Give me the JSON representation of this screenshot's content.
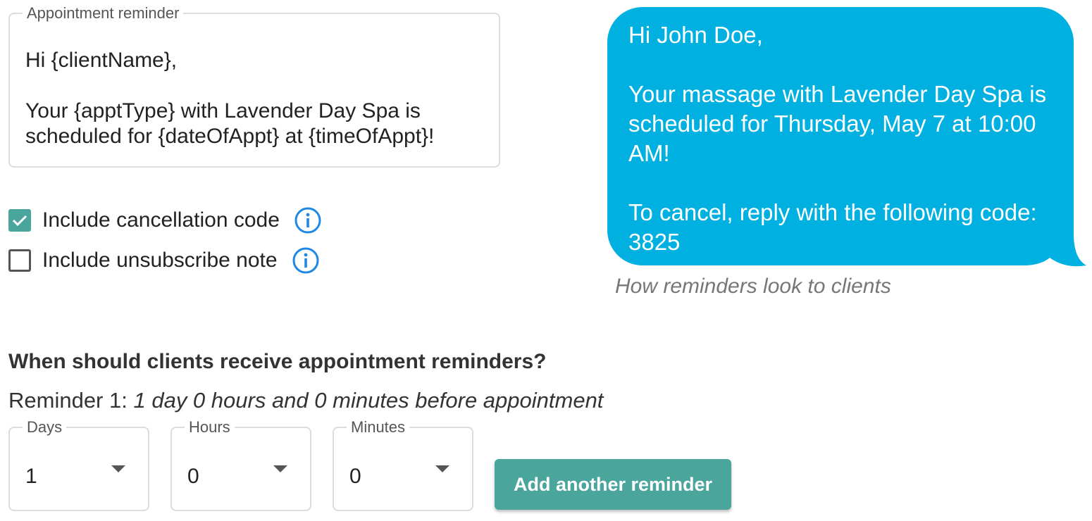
{
  "template": {
    "legend": "Appointment reminder",
    "text": "Hi {clientName},\n\nYour {apptType} with Lavender Day Spa is scheduled for {dateOfAppt} at {timeOfAppt}!"
  },
  "options": [
    {
      "label": "Include cancellation code",
      "checked": true
    },
    {
      "label": "Include unsubscribe note",
      "checked": false
    }
  ],
  "preview": {
    "message": "Hi John Doe,\n\nYour massage with Lavender Day Spa is scheduled for Thursday, May 7 at 10:00 AM!\n\nTo cancel, reply with the following code: 3825",
    "caption": "How reminders look to clients",
    "bubble_color": "#00b0e0"
  },
  "schedule": {
    "question": "When should clients receive appointment reminders?",
    "reminder_label": "Reminder 1:",
    "reminder_summary": "1 day 0 hours and 0 minutes before appointment",
    "selects": [
      {
        "label": "Days",
        "value": "1"
      },
      {
        "label": "Hours",
        "value": "0"
      },
      {
        "label": "Minutes",
        "value": "0"
      }
    ],
    "add_button": "Add another reminder"
  },
  "colors": {
    "accent": "#4aa59c",
    "info": "#1e88e5"
  }
}
